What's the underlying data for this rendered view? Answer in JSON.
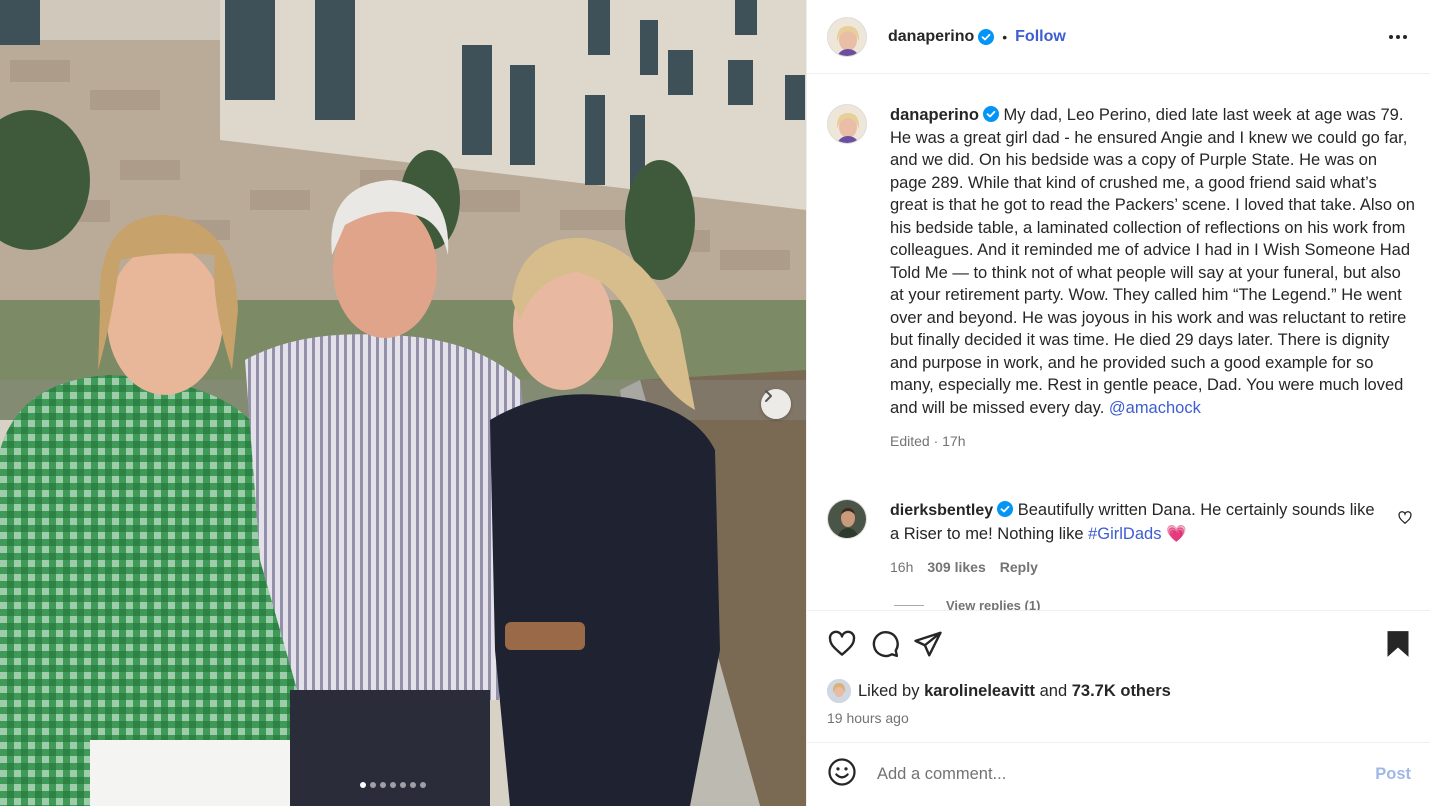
{
  "post": {
    "author": "danaperino",
    "follow_label": "Follow",
    "separator": "•",
    "caption": "My dad, Leo Perino, died late last week at age was 79. He was a great girl dad - he ensured Angie and I knew we could go far, and we did. On his bedside was a copy of Purple State. He was on page 289. While that kind of crushed me, a good friend said what’s great is that he got to read the Packers’ scene. I loved that take. Also on his bedside table, a laminated collection of reflections on his work from colleagues. And it reminded me of advice I had in I Wish Someone Had Told Me — to think not of what people will say at your funeral, but also at your retirement party. Wow. They called him “The Legend.” He went over and beyond. He was joyous in his work and was reluctant to retire but finally decided it was time. He died 29 days later. There is dignity and purpose in work, and he provided such a good example for so many, especially me. Rest in gentle peace, Dad. You were much loved and will be missed every day.",
    "caption_mention": "@amachock",
    "caption_meta": "Edited · 17h"
  },
  "comments": [
    {
      "author": "dierksbentley",
      "text": "Beautifully written Dana. He certainly sounds like a Riser to me! Nothing like ",
      "hashtag": "#GirlDads",
      "emoji": "💗",
      "time": "16h",
      "likes": "309 likes",
      "reply_label": "Reply",
      "view_replies": "View replies (1)"
    }
  ],
  "likes_summary": {
    "prefix": "Liked by",
    "user": "karolineleavitt",
    "middle": "and",
    "count": "73.7K others"
  },
  "time_ago": "19 hours ago",
  "comment_box": {
    "placeholder": "Add a comment...",
    "post_label": "Post"
  },
  "carousel": {
    "slide_count": 7,
    "active_index": 0
  },
  "colors": {
    "link": "#3d5dd1",
    "verified": "#0095f6",
    "muted": "#737373"
  }
}
